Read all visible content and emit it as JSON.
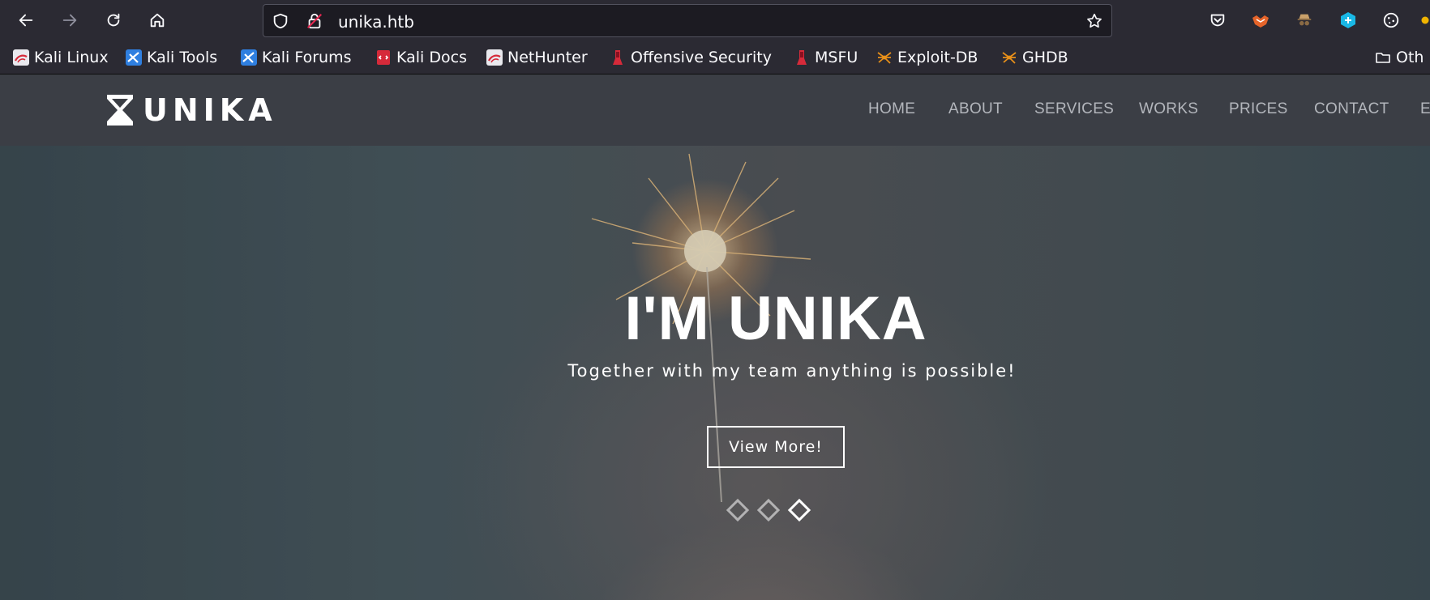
{
  "browser": {
    "url": "unika.htb",
    "icons": {
      "back": "back-arrow-icon",
      "forward": "forward-arrow-icon",
      "reload": "reload-icon",
      "home": "home-icon",
      "shield": "shield-icon",
      "lock": "lock-warning-icon",
      "star": "bookmark-star-icon"
    },
    "extensions": [
      "pocket-icon",
      "foxyproxy-icon",
      "spy-icon",
      "cube-extension-icon",
      "cookie-icon"
    ]
  },
  "bookmarks": [
    {
      "label": "Kali Linux",
      "icon": "kali-icon"
    },
    {
      "label": "Kali Tools",
      "icon": "kali-tools-icon"
    },
    {
      "label": "Kali Forums",
      "icon": "kali-forums-icon"
    },
    {
      "label": "Kali Docs",
      "icon": "kali-docs-icon"
    },
    {
      "label": "NetHunter",
      "icon": "nethunter-icon"
    },
    {
      "label": "Offensive Security",
      "icon": "offsec-icon"
    },
    {
      "label": "MSFU",
      "icon": "msfu-icon"
    },
    {
      "label": "Exploit-DB",
      "icon": "exploitdb-icon"
    },
    {
      "label": "GHDB",
      "icon": "ghdb-icon"
    },
    {
      "label": "Oth",
      "icon": "folder-icon"
    }
  ],
  "site": {
    "logo_text": "UNIKA",
    "nav": [
      "HOME",
      "ABOUT",
      "SERVICES",
      "WORKS",
      "PRICES",
      "CONTACT",
      "E"
    ],
    "hero": {
      "title": "I'M UNIKA",
      "subtitle": "Together with my team anything is possible!",
      "button": "View More!",
      "slides": 3,
      "active_slide": 3
    }
  },
  "colors": {
    "toolbar": "#2b2a33",
    "url_field": "#1c1b22",
    "navbar": "#3b3e45",
    "nav_text": "#b3b6bc"
  }
}
